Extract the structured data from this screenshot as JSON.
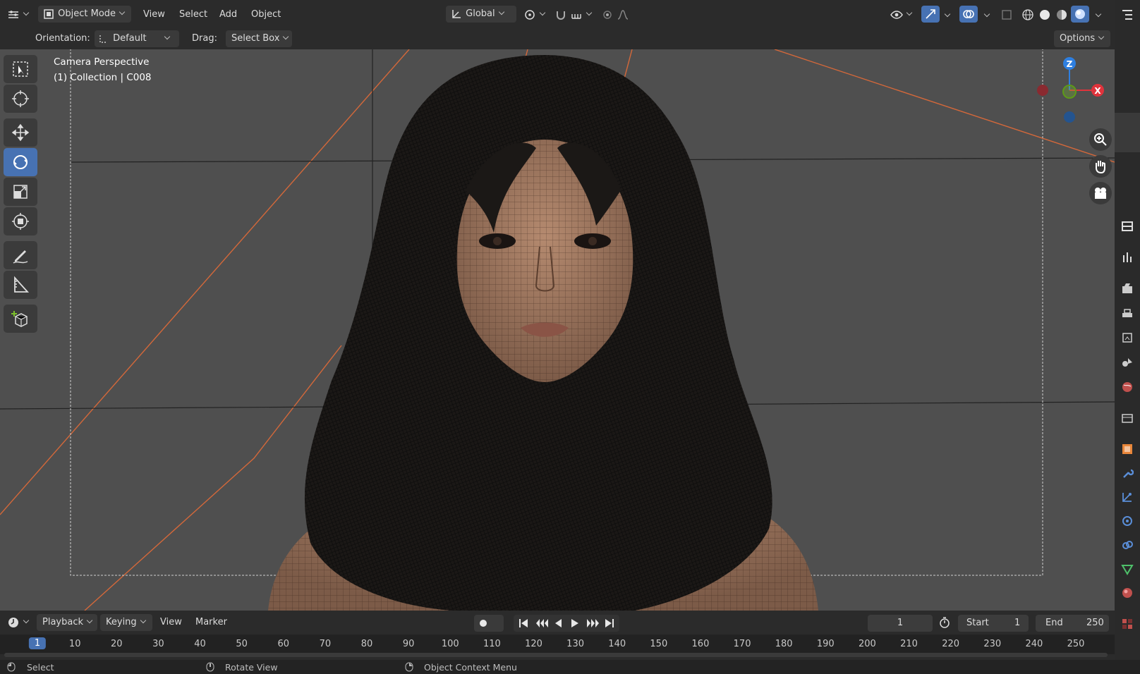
{
  "header": {
    "mode": "Object Mode",
    "menus": [
      "View",
      "Select",
      "Add",
      "Object"
    ],
    "transform_orientation": "Global"
  },
  "tool_header": {
    "orientation_label": "Orientation:",
    "orientation_value": "Default",
    "drag_label": "Drag:",
    "drag_value": "Select Box",
    "options": "Options"
  },
  "viewport": {
    "camera_label": "Camera Perspective",
    "collection_label": "(1) Collection | C008",
    "gizmo": {
      "z": "Z",
      "x": "X"
    }
  },
  "toolbar": {
    "tools": [
      "select-box",
      "cursor",
      "move",
      "rotate",
      "scale",
      "transform",
      "annotate",
      "measure",
      "add-cube"
    ],
    "active": "rotate"
  },
  "timeline": {
    "menus": [
      "Playback",
      "Keying",
      "View",
      "Marker"
    ],
    "current_frame": "1",
    "start_label": "Start",
    "start_value": "1",
    "end_label": "End",
    "end_value": "250",
    "ruler": [
      "1",
      "10",
      "20",
      "30",
      "40",
      "50",
      "60",
      "70",
      "80",
      "90",
      "100",
      "110",
      "120",
      "130",
      "140",
      "150",
      "160",
      "170",
      "180",
      "190",
      "200",
      "210",
      "220",
      "230",
      "240",
      "250"
    ]
  },
  "statusbar": {
    "select": "Select",
    "rotate_view": "Rotate View",
    "context_menu": "Object Context Menu"
  },
  "colors": {
    "accent": "#4772b3",
    "viewport_bg": "#4f4f4f",
    "camera_line": "#d4683a",
    "axis_x": "#e0333c",
    "axis_y": "#7bbf2a",
    "axis_z": "#2e7fe0"
  }
}
